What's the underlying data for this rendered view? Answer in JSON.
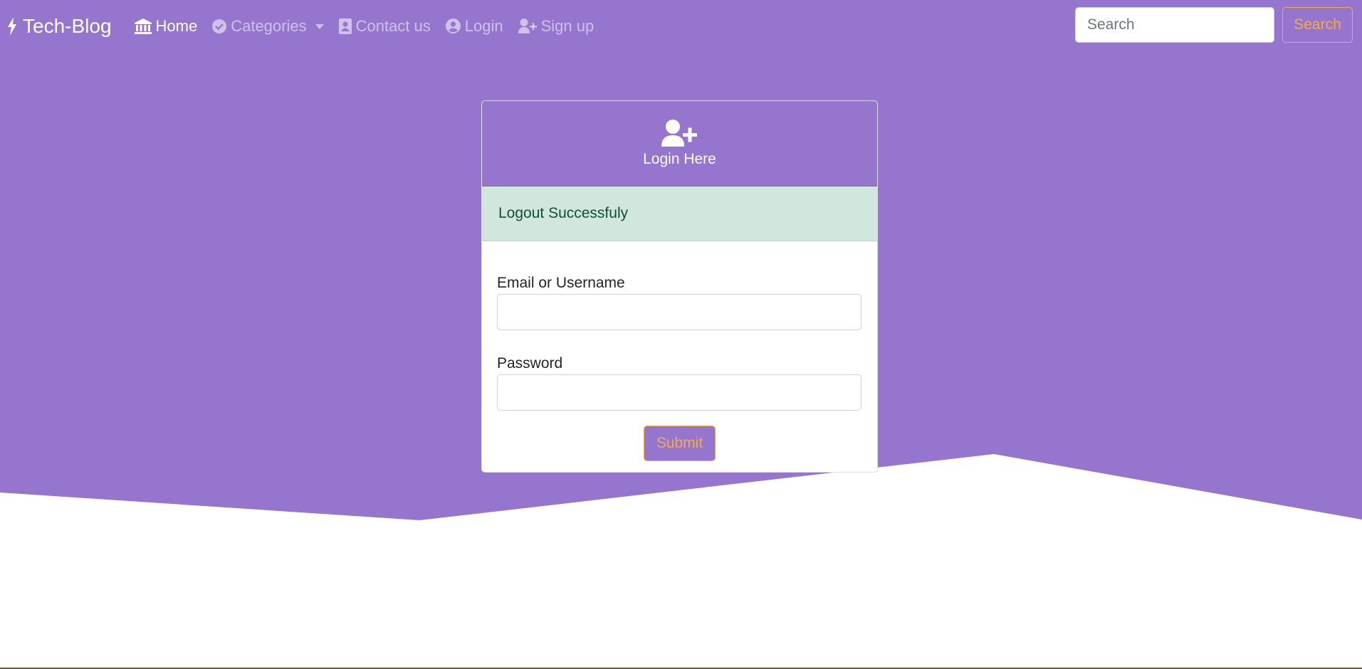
{
  "colors": {
    "primary": "#9575cd",
    "warning": "#f0ad4e",
    "alert_bg": "#d1e7dd",
    "alert_text": "#0f5132",
    "white": "#ffffff"
  },
  "navbar": {
    "brand": {
      "icon": "bolt-icon",
      "label": "Tech-Blog"
    },
    "items": [
      {
        "icon": "bank-icon",
        "label": "Home",
        "active": true
      },
      {
        "icon": "check-circle-icon",
        "label": "Categories",
        "dropdown": true
      },
      {
        "icon": "address-book-icon",
        "label": "Contact us"
      },
      {
        "icon": "user-circle-icon",
        "label": "Login"
      },
      {
        "icon": "user-plus-icon",
        "label": "Sign up"
      }
    ],
    "search": {
      "placeholder": "Search",
      "button_label": "Search"
    }
  },
  "login_card": {
    "header_icon": "user-plus-icon",
    "title": "Login Here",
    "alert": "Logout Successfuly",
    "fields": [
      {
        "label": "Email or Username",
        "value": ""
      },
      {
        "label": "Password",
        "value": ""
      }
    ],
    "submit_label": "Submit"
  }
}
